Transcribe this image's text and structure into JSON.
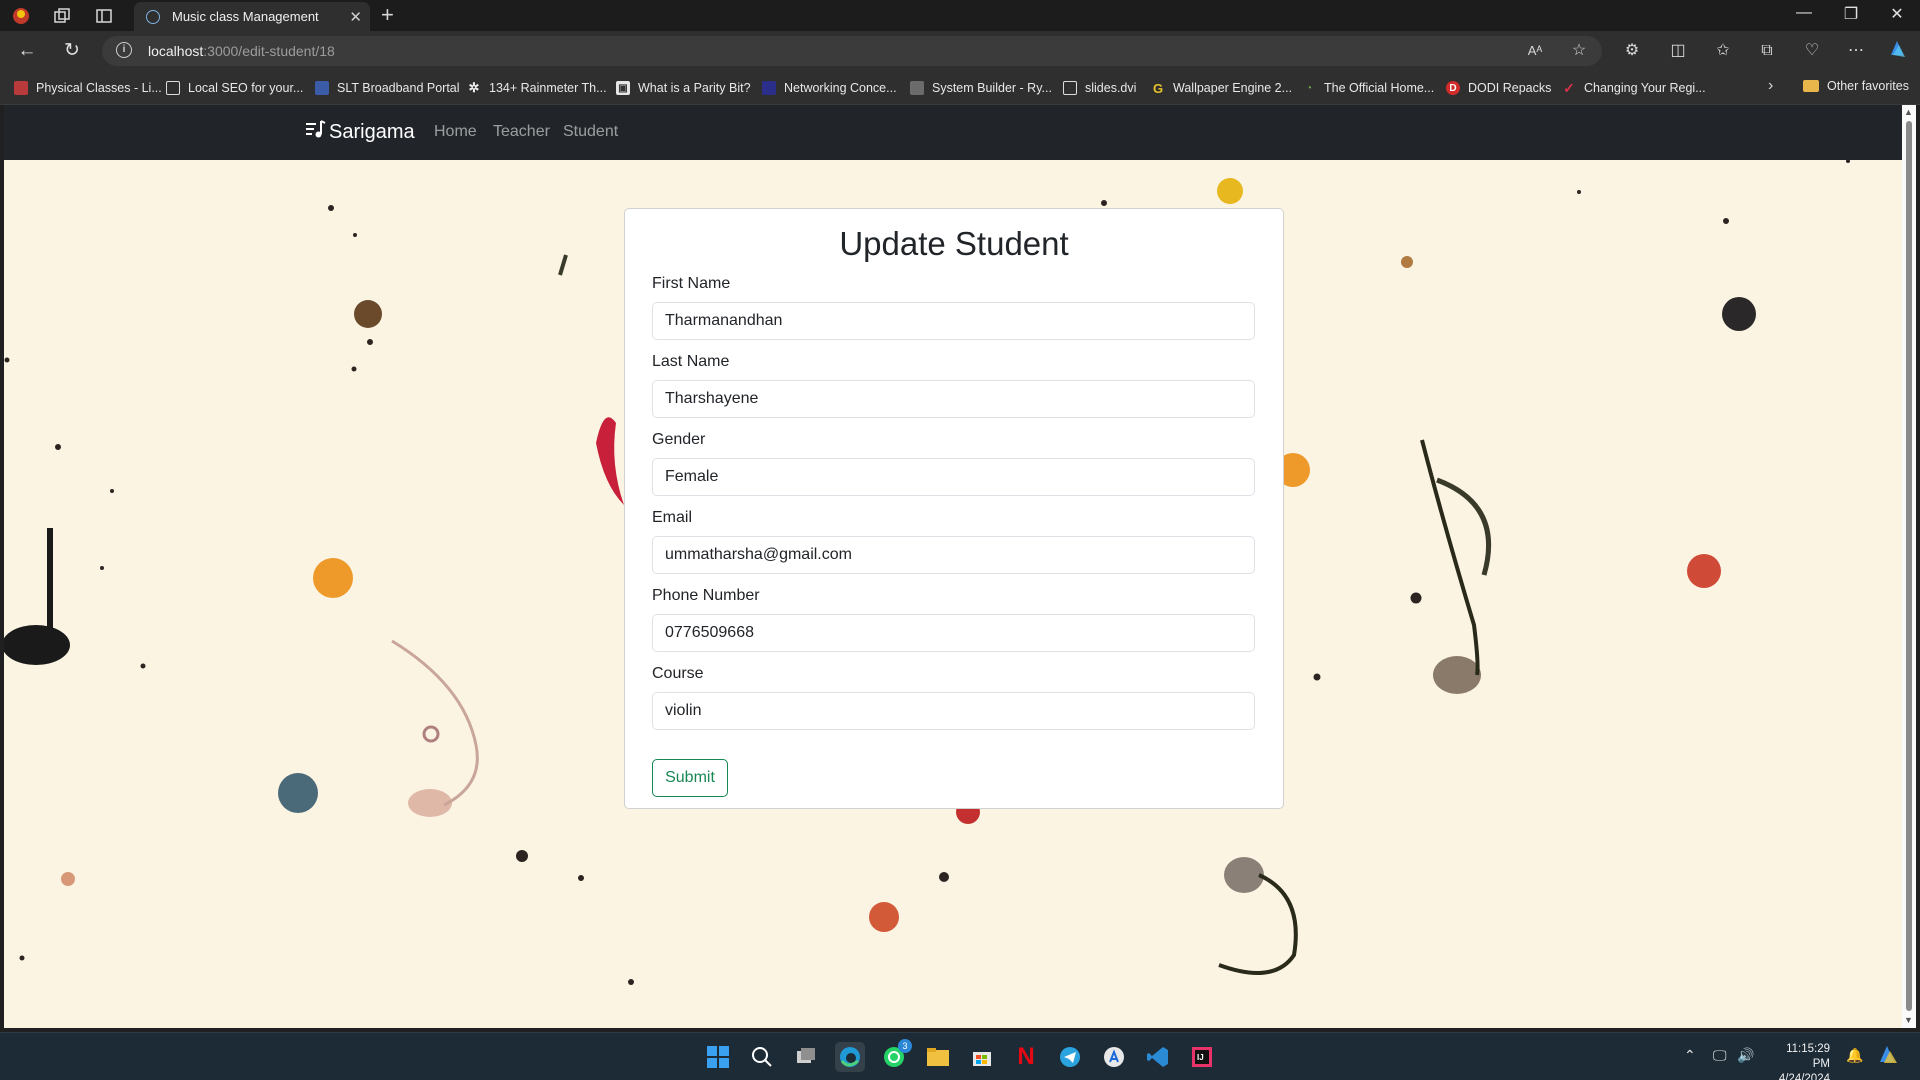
{
  "browser": {
    "tab_title": "Music class Management",
    "url_host": "localhost",
    "url_path": ":3000/edit-student/18",
    "favorites": [
      {
        "label": "Physical Classes - Li...",
        "icon": "red-logo-icon"
      },
      {
        "label": "Local SEO for your...",
        "icon": "page-icon"
      },
      {
        "label": "SLT Broadband Portal",
        "icon": "slt-logo-icon"
      },
      {
        "label": "134+ Rainmeter Th...",
        "icon": "gear-icon"
      },
      {
        "label": "What is a Parity Bit?",
        "icon": "site-icon"
      },
      {
        "label": "Networking Conce...",
        "icon": "site-icon"
      },
      {
        "label": "System Builder - Ry...",
        "icon": "site-icon"
      },
      {
        "label": "slides.dvi",
        "icon": "page-icon"
      },
      {
        "label": "Wallpaper Engine 2...",
        "icon": "g-logo-icon"
      },
      {
        "label": "The Official Home...",
        "icon": "leaf-icon"
      },
      {
        "label": "DODI Repacks",
        "icon": "d-logo-icon"
      },
      {
        "label": "Changing Your Regi...",
        "icon": "check-logo-icon"
      }
    ],
    "other_favorites": "Other favorites"
  },
  "site": {
    "brand": "Sarigama",
    "nav": [
      "Home",
      "Teacher",
      "Student"
    ]
  },
  "form": {
    "title": "Update Student",
    "fields": [
      {
        "label": "First Name",
        "value": "Tharmanandhan"
      },
      {
        "label": "Last Name",
        "value": "Tharshayene"
      },
      {
        "label": "Gender",
        "value": "Female"
      },
      {
        "label": "Email",
        "value": "ummatharsha@gmail.com"
      },
      {
        "label": "Phone Number",
        "value": "0776509668"
      },
      {
        "label": "Course",
        "value": "violin"
      }
    ],
    "submit_label": "Submit"
  },
  "taskbar": {
    "time": "11:15:29 PM",
    "date": "4/24/2024",
    "whatsapp_badge": "3"
  },
  "colors": {
    "page_bg": "#fbf4e2",
    "navbar_bg": "#212529",
    "submit_green": "#198754"
  }
}
